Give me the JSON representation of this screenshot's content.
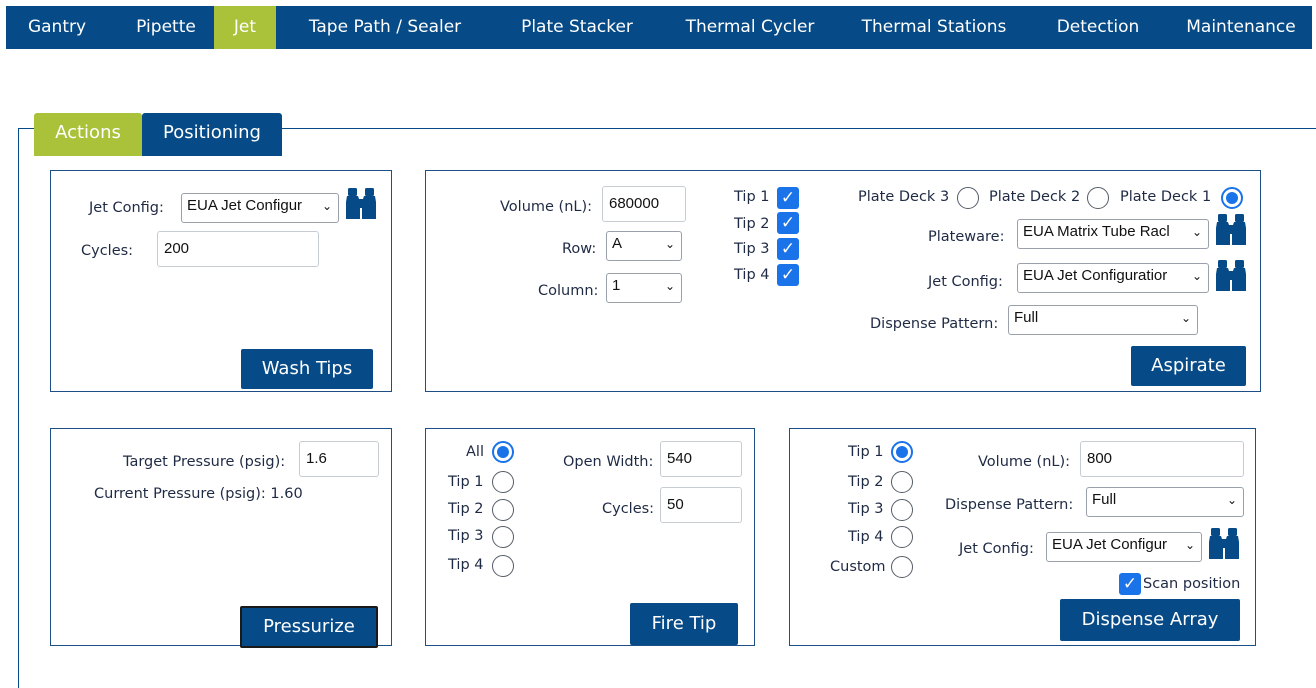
{
  "nav": {
    "items": [
      "Gantry",
      "Pipette",
      "Jet",
      "Tape Path / Sealer",
      "Plate Stacker",
      "Thermal Cycler",
      "Thermal Stations",
      "Detection",
      "Maintenance"
    ],
    "active": "Jet"
  },
  "tabs": {
    "actions": "Actions",
    "positioning": "Positioning",
    "active": "Actions"
  },
  "wash": {
    "jet_config_label": "Jet Config:",
    "jet_config_value": "EUA Jet Configur",
    "cycles_label": "Cycles:",
    "cycles_value": "200",
    "button": "Wash Tips"
  },
  "aspirate": {
    "volume_label": "Volume (nL):",
    "volume_value": "680000",
    "row_label": "Row:",
    "row_value": "A",
    "column_label": "Column:",
    "column_value": "1",
    "tips": [
      {
        "label": "Tip 1",
        "checked": true
      },
      {
        "label": "Tip 2",
        "checked": true
      },
      {
        "label": "Tip 3",
        "checked": true
      },
      {
        "label": "Tip 4",
        "checked": true
      }
    ],
    "decks": [
      {
        "label": "Plate Deck 3",
        "selected": false
      },
      {
        "label": "Plate Deck 2",
        "selected": false
      },
      {
        "label": "Plate Deck 1",
        "selected": true
      }
    ],
    "plateware_label": "Plateware:",
    "plateware_value": "EUA Matrix Tube Racl",
    "jet_config_label": "Jet Config:",
    "jet_config_value": "EUA Jet Configuratior",
    "dispense_pattern_label": "Dispense Pattern:",
    "dispense_pattern_value": "Full",
    "button": "Aspirate"
  },
  "pressure": {
    "target_label": "Target Pressure (psig):",
    "target_value": "1.6",
    "current_text": "Current Pressure (psig): 1.60",
    "button": "Pressurize"
  },
  "fire": {
    "options": [
      {
        "label": "All",
        "selected": true
      },
      {
        "label": "Tip 1",
        "selected": false
      },
      {
        "label": "Tip 2",
        "selected": false
      },
      {
        "label": "Tip 3",
        "selected": false
      },
      {
        "label": "Tip 4",
        "selected": false
      }
    ],
    "open_width_label": "Open Width:",
    "open_width_value": "540",
    "cycles_label": "Cycles:",
    "cycles_value": "50",
    "button": "Fire Tip"
  },
  "dispense": {
    "options": [
      {
        "label": "Tip 1",
        "selected": true
      },
      {
        "label": "Tip 2",
        "selected": false
      },
      {
        "label": "Tip 3",
        "selected": false
      },
      {
        "label": "Tip 4",
        "selected": false
      },
      {
        "label": "Custom",
        "selected": false
      }
    ],
    "volume_label": "Volume (nL):",
    "volume_value": "800",
    "dispense_pattern_label": "Dispense Pattern:",
    "dispense_pattern_value": "Full",
    "jet_config_label": "Jet Config:",
    "jet_config_value": "EUA Jet Configur",
    "scan_label": "Scan position",
    "scan_checked": true,
    "button": "Dispense Array"
  },
  "colors": {
    "primary": "#064a87",
    "accent": "#a9c23a",
    "check": "#1a73e8"
  },
  "icons": {
    "search": "binoculars-icon",
    "dropdown": "chevron-down-icon"
  }
}
